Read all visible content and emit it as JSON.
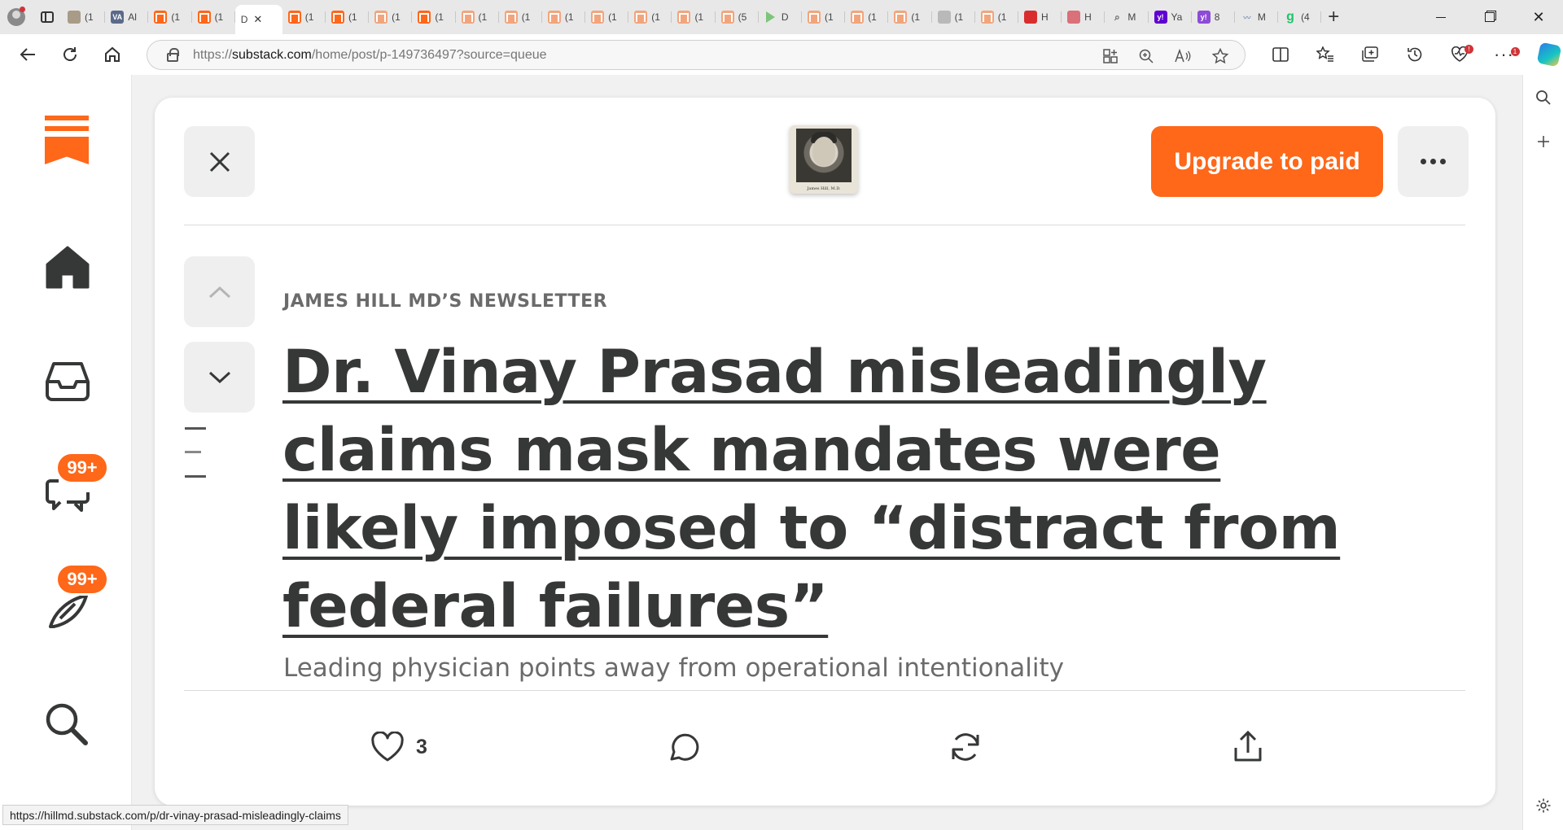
{
  "browser": {
    "tabs": [
      {
        "icon": "photo",
        "text": "(1"
      },
      {
        "icon": "va",
        "text": "Al",
        "badge": "VA"
      },
      {
        "icon": "substack",
        "text": "(1"
      },
      {
        "icon": "substack",
        "text": "(1"
      },
      {
        "icon": "active",
        "text": "D",
        "close": "✕"
      },
      {
        "icon": "substack",
        "text": "(1"
      },
      {
        "icon": "substack",
        "text": "(1"
      },
      {
        "icon": "substack-faded",
        "text": "(1"
      },
      {
        "icon": "substack",
        "text": "(1"
      },
      {
        "icon": "substack-faded",
        "text": "(1"
      },
      {
        "icon": "substack-faded",
        "text": "(1"
      },
      {
        "icon": "substack-faded",
        "text": "(1"
      },
      {
        "icon": "substack-faded",
        "text": "(1"
      },
      {
        "icon": "substack-faded",
        "text": "(1"
      },
      {
        "icon": "substack-faded",
        "text": "(1"
      },
      {
        "icon": "substack-faded",
        "text": "(5"
      },
      {
        "icon": "play",
        "text": "D"
      },
      {
        "icon": "substack-faded",
        "text": "(1"
      },
      {
        "icon": "substack-faded",
        "text": "(1"
      },
      {
        "icon": "substack-faded",
        "text": "(1"
      },
      {
        "icon": "gray",
        "text": "(1"
      },
      {
        "icon": "substack-faded",
        "text": "(1"
      },
      {
        "icon": "red",
        "text": "H"
      },
      {
        "icon": "pink",
        "text": "H"
      },
      {
        "icon": "search",
        "text": "M"
      },
      {
        "icon": "yahoo",
        "text": "Ya",
        "badge": "y!"
      },
      {
        "icon": "yahoo2",
        "text": "8",
        "badge": "y!"
      },
      {
        "icon": "wave",
        "text": "M"
      },
      {
        "icon": "g",
        "text": "(4",
        "badge": "g"
      }
    ],
    "new_tab_label": "+",
    "url_prefix": "https://",
    "url_domain": "substack.com",
    "url_path": "/home/post/p-149736497?source=queue",
    "status_link": "https://hillmd.substack.com/p/dr-vinay-prasad-misleadingly-claims",
    "notification_count": "1"
  },
  "substack": {
    "accent_color": "#ff6719",
    "nav": {
      "chat_badge": "99+",
      "activity_badge": "99+"
    },
    "post": {
      "publication": "JAMES HILL MD’S NEWSLETTER",
      "title": "Dr. Vinay Prasad misleadingly claims mask mandates were likely imposed to “distract from federal failures”",
      "subtitle": "Leading physician points away from operational intentionality",
      "upgrade_label": "Upgrade to paid",
      "avatar_caption": "James Hill, M.D.",
      "like_count": "3"
    }
  }
}
